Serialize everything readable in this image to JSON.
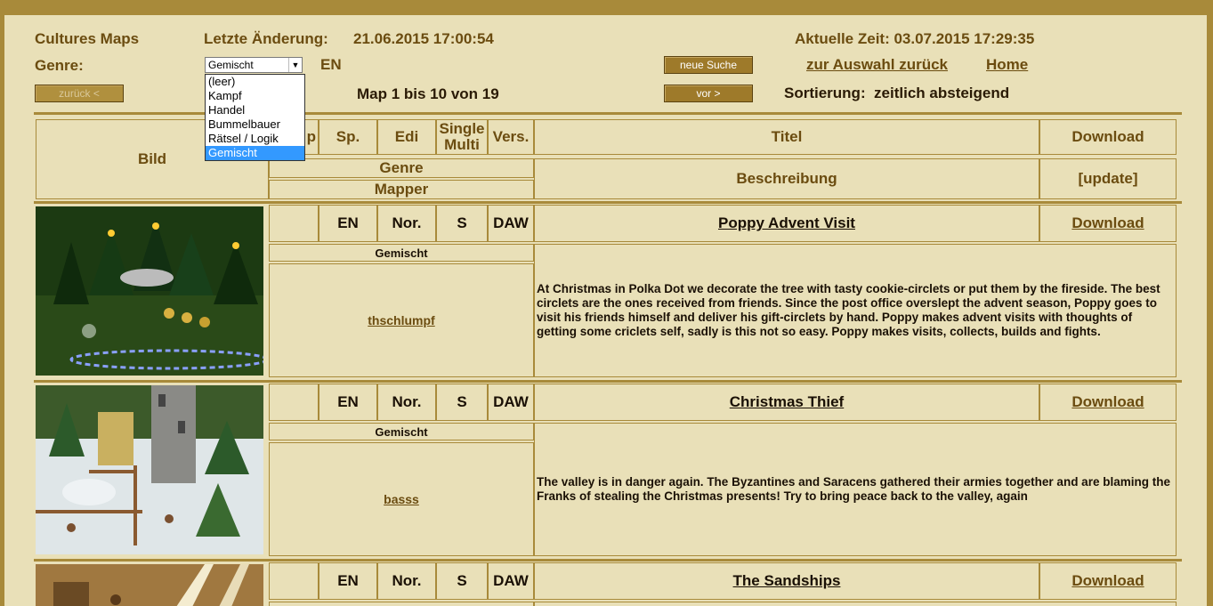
{
  "header": {
    "site_title": "Cultures Maps",
    "last_change_label": "Letzte Änderung:",
    "last_change_value": "21.06.2015 17:00:54",
    "current_time": "Aktuelle Zeit: 03.07.2015 17:29:35",
    "genre_label": "Genre:",
    "genre_selected": "Gemischt",
    "lang": "EN",
    "new_search": "neue Suche",
    "back_to_selection": "zur Auswahl zurück",
    "home": "Home",
    "prev_button": "zurück <",
    "next_button": "vor >",
    "range_text": "Map 1 bis 10 von 19",
    "sort_text": "Sortierung:  zeitlich absteigend"
  },
  "genre_options": [
    "(leer)",
    "Kampf",
    "Handel",
    "Bummelbauer",
    "Rätsel / Logik",
    "Gemischt"
  ],
  "table_header": {
    "bild": "Bild",
    "sp_partial": "p",
    "sp": "Sp.",
    "edi": "Edi",
    "single": "Single",
    "multi": "Multi",
    "vers": "Vers.",
    "titel": "Titel",
    "download": "Download",
    "genre": "Genre",
    "mapper": "Mapper",
    "beschreibung": "Beschreibung",
    "update": "[update]"
  },
  "maps": [
    {
      "lang": "EN",
      "edi": "Nor.",
      "mode": "S",
      "version": "DAW",
      "title": "Poppy Advent Visit",
      "download": "Download",
      "genre": "Gemischt",
      "mapper": "thschlumpf",
      "description": "At Christmas in Polka Dot we decorate the tree with tasty cookie-circlets or put them by the fireside. The best circlets are the ones received from friends. Since the post office overslept the advent season, Poppy goes to visit his friends himself and deliver his gift-circlets by hand. Poppy makes advent visits with thoughts of getting some criclets self, sadly is this not so easy. Poppy makes visits, collects, builds and fights."
    },
    {
      "lang": "EN",
      "edi": "Nor.",
      "mode": "S",
      "version": "DAW",
      "title": "Christmas Thief",
      "download": "Download",
      "genre": "Gemischt",
      "mapper": "basss",
      "description": "The valley is in danger again. The Byzantines and Saracens gathered their armies together and are blaming the Franks of stealing the Christmas presents! Try to bring peace back to the valley, again"
    },
    {
      "lang": "EN",
      "edi": "Nor.",
      "mode": "S",
      "version": "DAW",
      "title": "The Sandships",
      "download": "Download"
    }
  ]
}
